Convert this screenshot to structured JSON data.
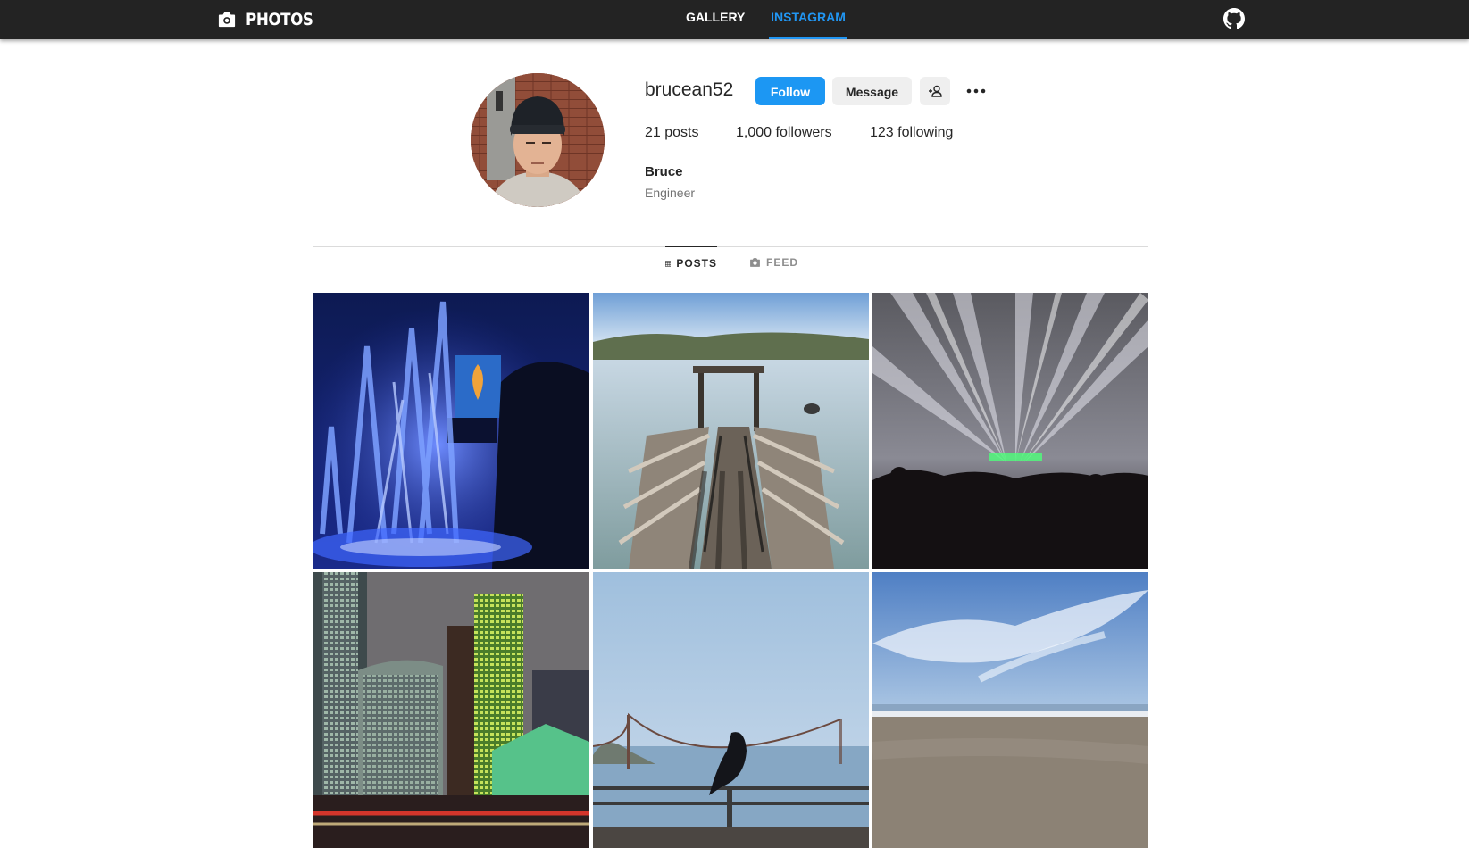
{
  "app": {
    "title": "PHOTOS"
  },
  "nav": {
    "tabs": [
      {
        "label": "GALLERY"
      },
      {
        "label": "INSTAGRAM"
      }
    ],
    "active": "INSTAGRAM"
  },
  "profile": {
    "username": "brucean52",
    "follow_label": "Follow",
    "message_label": "Message",
    "stats": {
      "posts": "21",
      "posts_label": "posts",
      "followers": "1,000",
      "followers_label": "followers",
      "following": "123",
      "following_label": "following"
    },
    "display_name": "Bruce",
    "bio": "Engineer"
  },
  "profile_tabs": [
    {
      "label": "POSTS",
      "icon": "grid-icon"
    },
    {
      "label": "FEED",
      "icon": "camera-icon"
    }
  ],
  "posts": [
    {
      "subject": "fountain-night"
    },
    {
      "subject": "pier-lake"
    },
    {
      "subject": "concert-lights"
    },
    {
      "subject": "city-towers"
    },
    {
      "subject": "bridge-bird"
    },
    {
      "subject": "beach-sky"
    }
  ],
  "colors": {
    "accent": "#1c97f3",
    "topbar": "#232323",
    "active_tab": "#2196f3"
  }
}
